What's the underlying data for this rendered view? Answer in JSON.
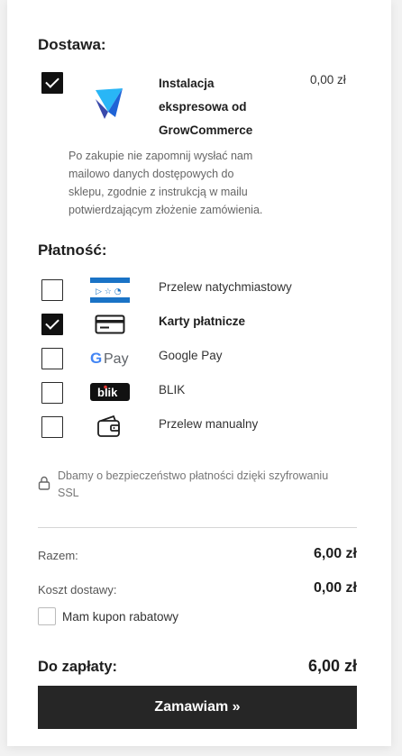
{
  "delivery": {
    "title": "Dostawa:",
    "item": {
      "name_lines": [
        "Instalacja",
        "ekspresowa od",
        "GrowCommerce"
      ],
      "price": "0,00 zł",
      "checked": true,
      "icon": "growcommerce-logo-icon"
    },
    "note_lines": [
      "Po zakupie nie zapomnij wysłać nam",
      "mailowo danych dostępowych do",
      "sklepu, zgodnie z instrukcją w mailu",
      "potwierdzającym złożenie zamówienia."
    ]
  },
  "payment": {
    "title": "Płatność:",
    "options": [
      {
        "label": "Przelew natychmiastowy",
        "icon": "bluemedia-icon",
        "checked": false,
        "logo_text": "BLUE MEDIA"
      },
      {
        "label": "Karty płatnicze",
        "icon": "credit-card-icon",
        "checked": true
      },
      {
        "label": "Google Pay",
        "icon": "google-pay-icon",
        "checked": false,
        "logo_text": "Pay"
      },
      {
        "label": "BLIK",
        "icon": "blik-icon",
        "checked": false,
        "logo_text": "blik"
      },
      {
        "label": "Przelew manualny",
        "icon": "wallet-icon",
        "checked": false
      }
    ]
  },
  "security": {
    "icon": "lock-icon",
    "text_lines": [
      "Dbamy o bezpieczeństwo płatności dzięki szyfrowaniu",
      "SSL"
    ]
  },
  "summary": {
    "subtotal_label": "Razem:",
    "subtotal_value": "6,00 zł",
    "shipping_label": "Koszt dostawy:",
    "shipping_value": "0,00 zł",
    "coupon_label": "Mam kupon rabatowy",
    "total_label": "Do zapłaty:",
    "total_value": "6,00 zł"
  },
  "order_button": "Zamawiam »",
  "colors": {
    "button_bg": "#262626",
    "accent_blue": "#1e88e5",
    "blue_media": "#1a73c6"
  }
}
